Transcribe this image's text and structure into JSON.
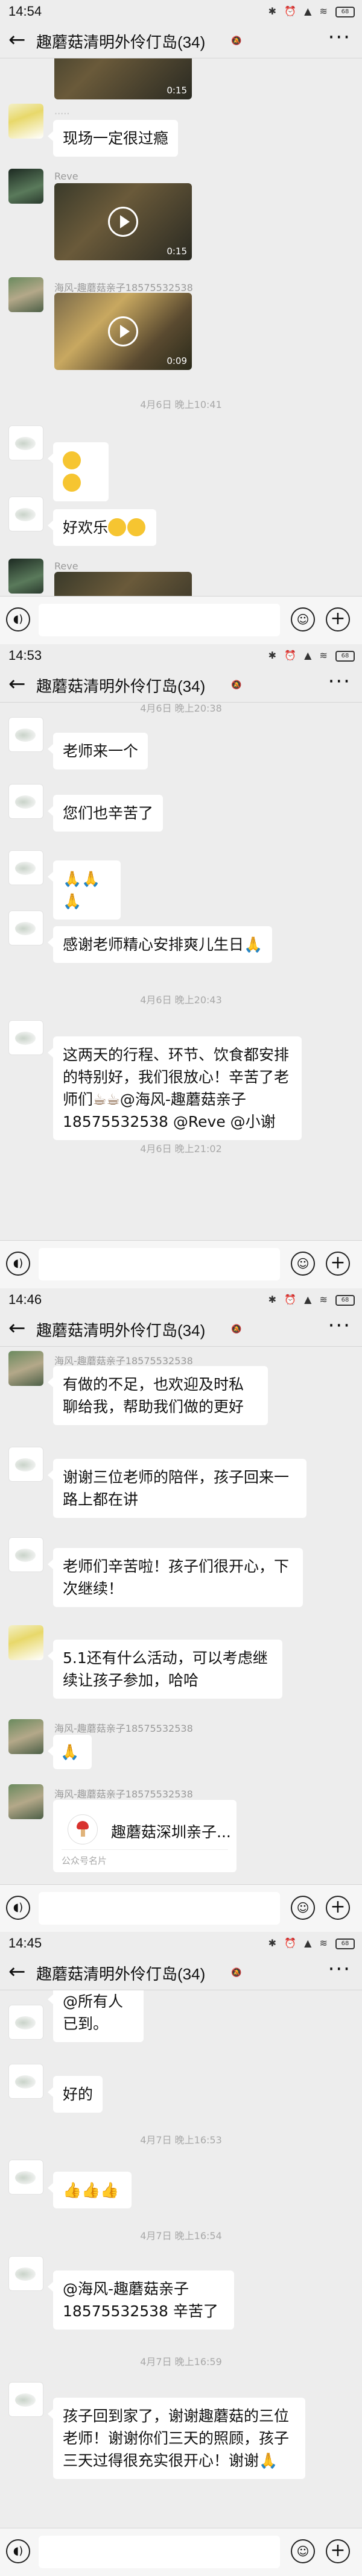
{
  "screens": [
    {
      "status_time": "14:54",
      "battery": "68",
      "group_title": "趣蘑菇清明外伶仃岛(34)",
      "video_durations": [
        "0:15",
        "0:15",
        "0:09"
      ],
      "nicks": [
        "Reve",
        "海风-趣蘑菇亲子18575532538",
        "Reve"
      ],
      "messages": [
        "现场一定很过瘾",
        "好欢乐"
      ],
      "time_sep": "4月6日 晚上10:41"
    },
    {
      "status_time": "14:53",
      "battery": "68",
      "group_title": "趣蘑菇清明外伶仃岛(34)",
      "top_sep": "4月6日 晚上20:38",
      "messages": [
        "老师来一个",
        "您们也辛苦了",
        "感谢老师精心安排爽儿生日",
        "这两天的行程、环节、饮食都安排的特别好，我们很放心！辛苦了老师们",
        "@海风-趣蘑菇亲子18575532538 @Reve @小谢"
      ],
      "time_seps": [
        "4月6日 晚上20:43",
        "4月6日 晚上21:02"
      ]
    },
    {
      "status_time": "14:46",
      "battery": "68",
      "group_title": "趣蘑菇清明外伶仃岛(34)",
      "nicks": [
        "海风-趣蘑菇亲子18575532538",
        "海风-趣蘑菇亲子18575532538",
        "海风-趣蘑菇亲子18575532538"
      ],
      "messages": [
        "有做的不足，也欢迎及时私聊给我，帮助我们做的更好",
        "谢谢三位老师的陪伴，孩子回来一路上都在讲",
        "老师们辛苦啦！孩子们很开心，下次继续！",
        "5.1还有什么活动，可以考虑继续让孩子参加，哈哈"
      ],
      "card": {
        "name": "趣蘑菇深圳亲子...",
        "type": "公众号名片"
      }
    },
    {
      "status_time": "14:45",
      "battery": "68",
      "group_title": "趣蘑菇清明外伶仃岛(34)",
      "messages": [
        "@所有人 已到。",
        "好的",
        "@海风-趣蘑菇亲子18575532538 辛苦了",
        "孩子回到家了，谢谢趣蘑菇的三位老师！谢谢你们三天的照顾，孩子三天过得很充实很开心！谢谢"
      ],
      "time_seps": [
        "4月7日 晚上16:53",
        "4月7日 晚上16:54",
        "4月7日 晚上16:59"
      ]
    }
  ]
}
